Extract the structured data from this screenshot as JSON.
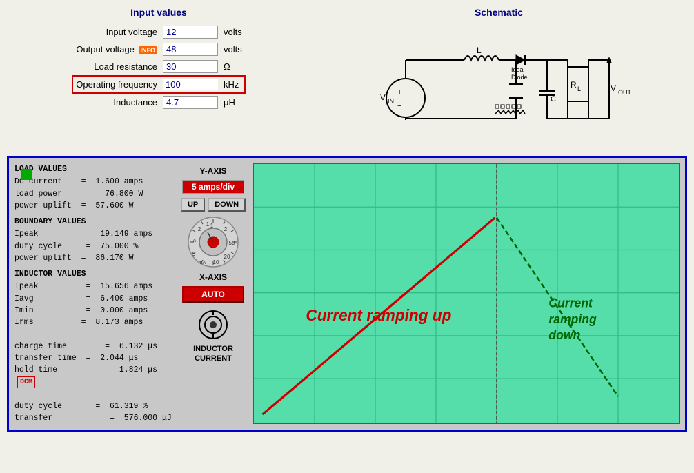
{
  "header": {
    "input_values_title": "Input values",
    "schematic_title": "Schematic"
  },
  "input_fields": {
    "input_voltage_label": "Input voltage",
    "input_voltage_value": "12",
    "input_voltage_unit": "volts",
    "output_voltage_label": "Output voltage",
    "output_voltage_value": "48",
    "output_voltage_unit": "volts",
    "info_badge": "INFO",
    "load_resistance_label": "Load resistance",
    "load_resistance_value": "30",
    "load_resistance_unit": "Ω",
    "operating_frequency_label": "Operating frequency",
    "operating_frequency_value": "100",
    "operating_frequency_unit": "kHz",
    "inductance_label": "Inductance",
    "inductance_value": "4.7",
    "inductance_unit": "μH"
  },
  "osc": {
    "green_square": "",
    "y_axis_label": "Y-AXIS",
    "y_axis_value": "5 amps/div",
    "up_btn": "UP",
    "down_btn": "DOWN",
    "x_axis_label": "X-AXIS",
    "auto_btn": "AUTO",
    "inductor_label_line1": "INDUCTOR",
    "inductor_label_line2": "CURRENT"
  },
  "load_values": {
    "section": "LOAD VALUES",
    "dc_current_label": "DC current",
    "dc_current_eq": "=",
    "dc_current_val": "1.600 amps",
    "load_power_label": "load power",
    "load_power_eq": "=",
    "load_power_val": "76.800 W",
    "power_uplift_label": "power uplift",
    "power_uplift_eq": "=",
    "power_uplift_val": "57.600 W"
  },
  "boundary_values": {
    "section": "BOUNDARY VALUES",
    "ipeak_label": "Ipeak",
    "ipeak_eq": "=",
    "ipeak_val": "19.149 amps",
    "duty_cycle_label": "duty cycle",
    "duty_cycle_eq": "=",
    "duty_cycle_val": "75.000 %",
    "power_uplift_label": "power uplift",
    "power_uplift_eq": "=",
    "power_uplift_val": "86.170 W"
  },
  "inductor_values": {
    "section": "INDUCTOR VALUES",
    "ipeak_label": "Ipeak",
    "ipeak_eq": "=",
    "ipeak_val": "15.656 amps",
    "iavg_label": "Iavg",
    "iavg_eq": "=",
    "iavg_val": "6.400 amps",
    "imin_label": "Imin",
    "imin_eq": "=",
    "imin_val": "0.000 amps",
    "irms_label": "Irms",
    "irms_eq": "=",
    "irms_val": "8.173 amps"
  },
  "timing": {
    "charge_time_label": "charge time",
    "charge_time_eq": "=",
    "charge_time_val": "6.132 μs",
    "transfer_time_label": "transfer time",
    "transfer_time_eq": "=",
    "transfer_time_val": "2.044 μs",
    "hold_time_label": "hold time",
    "hold_time_eq": "=",
    "hold_time_val": "1.824 μs",
    "dcm_badge": "DCM"
  },
  "duty": {
    "duty_cycle_label": "duty cycle",
    "duty_cycle_eq": "=",
    "duty_cycle_val": "61.319 %",
    "transfer_label": "transfer",
    "transfer_eq": "=",
    "transfer_val": "576.000 μJ"
  },
  "chart": {
    "current_ramp_up_label": "Current ramping up",
    "current_ramp_down_label": "Current\nramping\ndown"
  }
}
